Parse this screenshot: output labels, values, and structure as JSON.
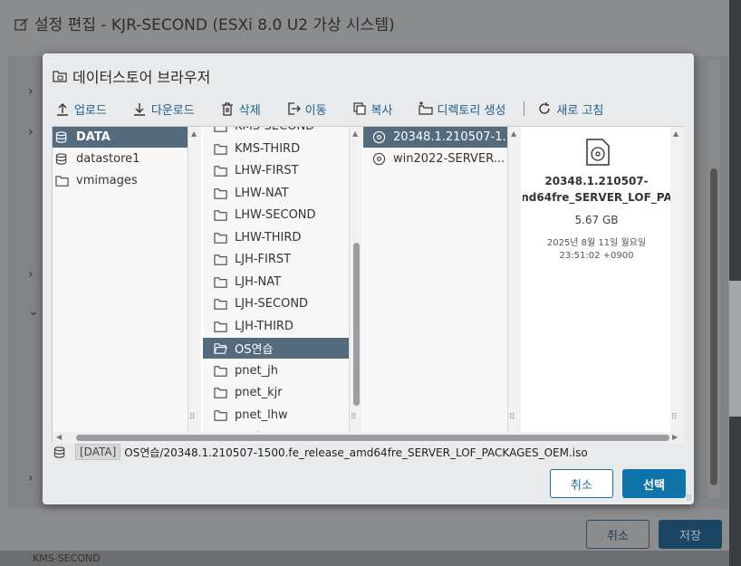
{
  "outer": {
    "title": "설정 편집 - KJR-SECOND (ESXi 8.0 U2 가상 시스템)",
    "cancel_label": "취소",
    "save_label": "저장",
    "bottom_text": "KMS-SECOND"
  },
  "dialog": {
    "title": "데이터스토어 브라우저",
    "toolbar": [
      {
        "label": "업로드",
        "icon": "upload-icon"
      },
      {
        "label": "다운로드",
        "icon": "download-icon"
      },
      {
        "label": "삭제",
        "icon": "trash-icon"
      },
      {
        "label": "이동",
        "icon": "move-icon"
      },
      {
        "label": "복사",
        "icon": "copy-icon"
      },
      {
        "label": "디렉토리 생성",
        "icon": "new-folder-icon"
      },
      {
        "label": "새로 고침",
        "icon": "refresh-icon"
      }
    ],
    "datastores": [
      {
        "label": "DATA",
        "selected": true
      },
      {
        "label": "datastore1",
        "selected": false
      },
      {
        "label": "vmimages",
        "selected": false
      }
    ],
    "folders": [
      {
        "label": "KMS-SECOND",
        "selected": false
      },
      {
        "label": "KMS-THIRD",
        "selected": false
      },
      {
        "label": "LHW-FIRST",
        "selected": false
      },
      {
        "label": "LHW-NAT",
        "selected": false
      },
      {
        "label": "LHW-SECOND",
        "selected": false
      },
      {
        "label": "LHW-THIRD",
        "selected": false
      },
      {
        "label": "LJH-FIRST",
        "selected": false
      },
      {
        "label": "LJH-NAT",
        "selected": false
      },
      {
        "label": "LJH-SECOND",
        "selected": false
      },
      {
        "label": "LJH-THIRD",
        "selected": false
      },
      {
        "label": "OS연습",
        "selected": true
      },
      {
        "label": "pnet_jh",
        "selected": false
      },
      {
        "label": "pnet_kjr",
        "selected": false
      },
      {
        "label": "pnet_lhw",
        "selected": false
      },
      {
        "label": "pnet_...",
        "selected": false
      }
    ],
    "files": [
      {
        "label": "20348.1.210507-1...",
        "selected": true
      },
      {
        "label": "win2022-SERVER...",
        "selected": false
      }
    ],
    "preview": {
      "name_line1": "20348.1.210507-",
      "name_line2": "nd64fre_SERVER_LOF_PA",
      "size": "5.67 GB",
      "date_line1": "2025년 8월 11일 월요일",
      "date_line2": "23:51:02 +0900"
    },
    "path": {
      "datastore": "[DATA]",
      "value": "OS연습/20348.1.210507-1500.fe_release_amd64fre_SERVER_LOF_PACKAGES_OEM.iso"
    },
    "cancel_label": "취소",
    "ok_label": "선택"
  },
  "colors": {
    "accent": "#0f74aa",
    "selected_row": "#546b7e",
    "toolbar_text": "#1f5d8a"
  }
}
